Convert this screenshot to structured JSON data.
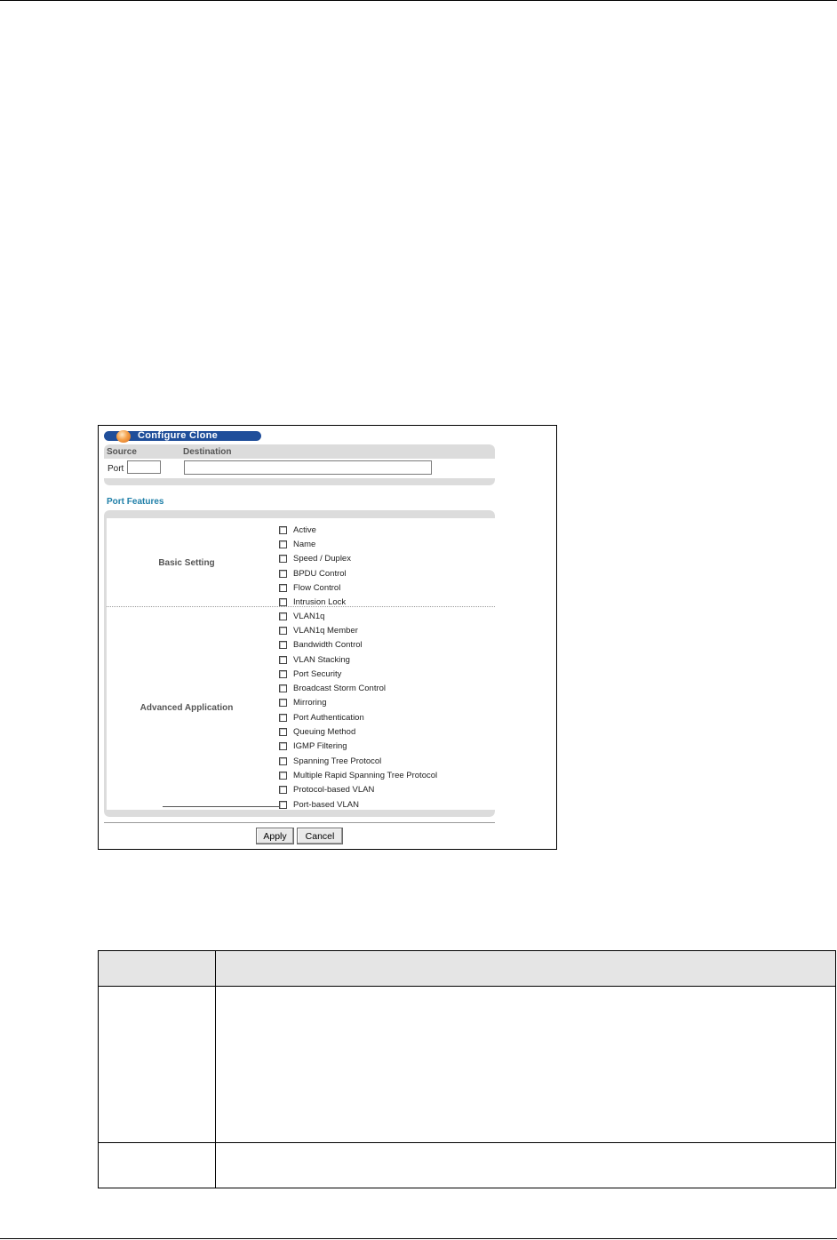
{
  "window": {
    "title": "Configure Clone"
  },
  "source_section": {
    "source_label": "Source",
    "destination_label": "Destination",
    "port_label": "Port",
    "port_value": "",
    "destination_value": ""
  },
  "port_features": {
    "heading": "Port Features",
    "basic": {
      "label": "Basic Setting",
      "items": [
        "Active",
        "Name",
        "Speed / Duplex",
        "BPDU Control",
        "Flow Control",
        "Intrusion Lock"
      ]
    },
    "advanced": {
      "label": "Advanced Application",
      "items": [
        "VLAN1q",
        "VLAN1q Member",
        "Bandwidth Control",
        "VLAN Stacking",
        "Port Security",
        "Broadcast Storm Control",
        "Mirroring",
        "Port Authentication",
        "Queuing Method",
        "IGMP Filtering",
        "Spanning Tree Protocol",
        "Multiple Rapid Spanning Tree Protocol",
        "Protocol-based VLAN",
        "Port-based VLAN"
      ]
    }
  },
  "buttons": {
    "apply": "Apply",
    "cancel": "Cancel"
  },
  "colors": {
    "title_bar": "#1f4e9a",
    "heading_accent": "#1f7fa8",
    "panel_grey": "#dcdcdc"
  }
}
